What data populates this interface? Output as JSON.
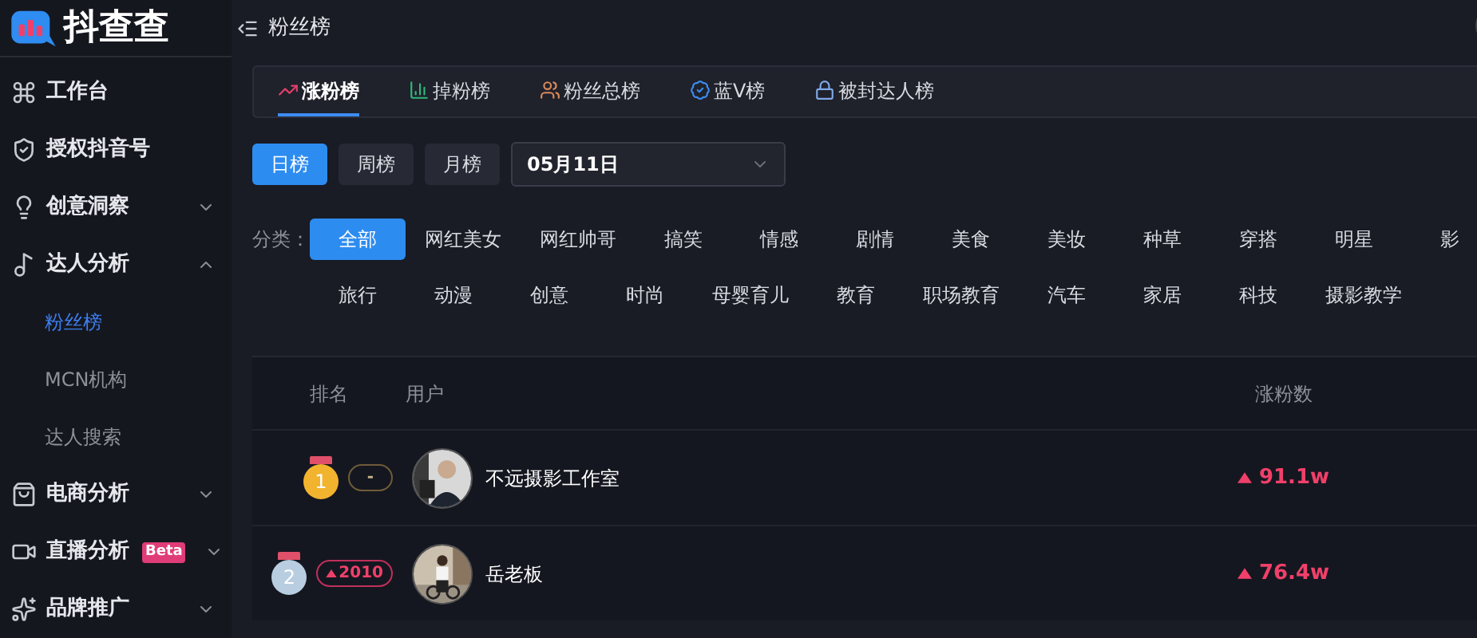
{
  "logo": {
    "text": "抖查查"
  },
  "header": {
    "title": "粉丝榜"
  },
  "sidebar": {
    "items": [
      {
        "label": "工作台",
        "kind": "plain"
      },
      {
        "label": "授权抖音号",
        "kind": "plain"
      },
      {
        "label": "创意洞察",
        "kind": "group",
        "expanded": false
      },
      {
        "label": "达人分析",
        "kind": "group",
        "expanded": true,
        "children": [
          {
            "label": "粉丝榜",
            "selected": true
          },
          {
            "label": "MCN机构",
            "selected": false
          },
          {
            "label": "达人搜索",
            "selected": false
          }
        ]
      },
      {
        "label": "电商分析",
        "kind": "group",
        "expanded": false
      },
      {
        "label": "直播分析",
        "kind": "group",
        "expanded": false,
        "badge": "Beta"
      },
      {
        "label": "品牌推广",
        "kind": "group",
        "expanded": false
      }
    ]
  },
  "tabs": [
    {
      "label": "涨粉榜",
      "selected": true
    },
    {
      "label": "掉粉榜",
      "selected": false
    },
    {
      "label": "粉丝总榜",
      "selected": false
    },
    {
      "label": "蓝V榜",
      "selected": false
    },
    {
      "label": "被封达人榜",
      "selected": false
    }
  ],
  "periods": [
    {
      "label": "日榜",
      "selected": true
    },
    {
      "label": "周榜",
      "selected": false
    },
    {
      "label": "月榜",
      "selected": false
    }
  ],
  "date_select": {
    "value": "05月11日"
  },
  "category_label": "分类：",
  "category_rows": [
    [
      {
        "label": "全部",
        "selected": true
      },
      {
        "label": "网红美女",
        "selected": false
      },
      {
        "label": "网红帅哥",
        "selected": false
      },
      {
        "label": "搞笑",
        "selected": false
      },
      {
        "label": "情感",
        "selected": false
      },
      {
        "label": "剧情",
        "selected": false
      },
      {
        "label": "美食",
        "selected": false
      },
      {
        "label": "美妆",
        "selected": false
      },
      {
        "label": "种草",
        "selected": false
      },
      {
        "label": "穿搭",
        "selected": false
      },
      {
        "label": "明星",
        "selected": false
      },
      {
        "label": "影",
        "selected": false
      }
    ],
    [
      {
        "label": "旅行",
        "selected": false
      },
      {
        "label": "动漫",
        "selected": false
      },
      {
        "label": "创意",
        "selected": false
      },
      {
        "label": "时尚",
        "selected": false
      },
      {
        "label": "母婴育儿",
        "selected": false
      },
      {
        "label": "教育",
        "selected": false
      },
      {
        "label": "职场教育",
        "selected": false
      },
      {
        "label": "汽车",
        "selected": false
      },
      {
        "label": "家居",
        "selected": false
      },
      {
        "label": "科技",
        "selected": false
      },
      {
        "label": "摄影教学",
        "selected": false
      }
    ]
  ],
  "table": {
    "columns": [
      "排名",
      "用户",
      "涨粉数"
    ],
    "rows": [
      {
        "rank": "1",
        "change": {
          "kind": "flat",
          "text": "-"
        },
        "user": "不远摄影工作室",
        "gain": "91.1w"
      },
      {
        "rank": "2",
        "change": {
          "kind": "up",
          "text": "2010"
        },
        "user": "岳老板",
        "gain": "76.4w"
      }
    ]
  }
}
